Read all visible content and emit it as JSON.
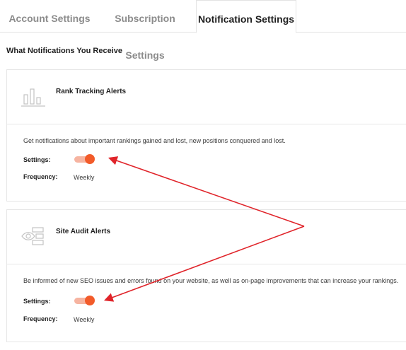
{
  "tabs": [
    {
      "label": "Account Settings",
      "active": false
    },
    {
      "label": "Subscription Settings",
      "active": false
    },
    {
      "label": "Notification Settings",
      "active": true
    }
  ],
  "section_title": "What Notifications You Receive",
  "cards": [
    {
      "icon": "bar-chart-icon",
      "title": "Rank Tracking Alerts",
      "description": "Get notifications about important rankings gained and lost, new positions conquered and lost.",
      "settings_label": "Settings:",
      "settings_on": true,
      "frequency_label": "Frequency:",
      "frequency_value": "Weekly"
    },
    {
      "icon": "site-audit-icon",
      "title": "Site Audit Alerts",
      "description": "Be informed of new SEO issues and errors found on your website, as well as on-page improvements that can increase your rankings.",
      "settings_label": "Settings:",
      "settings_on": true,
      "frequency_label": "Frequency:",
      "frequency_value": "Weekly"
    }
  ],
  "colors": {
    "toggle_on": "#f25b2a",
    "toggle_track": "#f6b4a1",
    "annotation_arrow": "#e0242a"
  }
}
